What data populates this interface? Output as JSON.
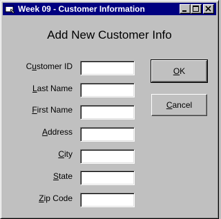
{
  "window": {
    "title": "Week 09 - Customer Information",
    "icon": "vb-form-icon",
    "controls": [
      "minimize-icon",
      "maximize-icon",
      "close-icon"
    ]
  },
  "form": {
    "heading": "Add New Customer Info",
    "fields": [
      {
        "label_pre": "C",
        "label_key": "u",
        "label_post": "stomer ID",
        "value": ""
      },
      {
        "label_pre": "",
        "label_key": "L",
        "label_post": "ast Name",
        "value": ""
      },
      {
        "label_pre": "",
        "label_key": "F",
        "label_post": "irst Name",
        "value": ""
      },
      {
        "label_pre": "",
        "label_key": "A",
        "label_post": "ddress",
        "value": ""
      },
      {
        "label_pre": "",
        "label_key": "C",
        "label_post": "ity",
        "value": ""
      },
      {
        "label_pre": "",
        "label_key": "S",
        "label_post": "tate",
        "value": ""
      },
      {
        "label_pre": "",
        "label_key": "Z",
        "label_post": "ip Code",
        "value": ""
      }
    ]
  },
  "buttons": {
    "ok": {
      "key": "O",
      "rest": "K"
    },
    "cancel": {
      "key": "C",
      "rest": "ancel"
    }
  },
  "colors": {
    "face": "#c0c0c0",
    "titlebar": "#000080",
    "title_text": "#ffffff"
  }
}
